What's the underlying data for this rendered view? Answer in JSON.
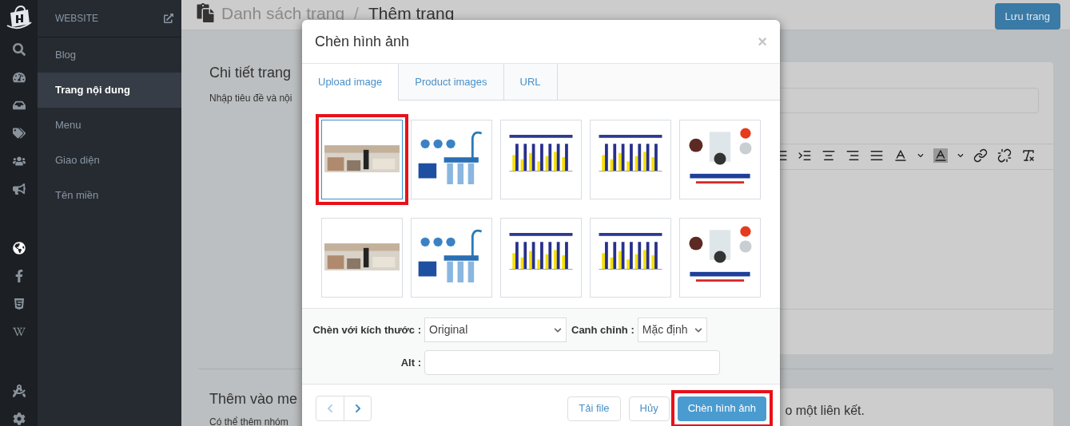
{
  "rail": {
    "icons": [
      {
        "kind": "search"
      },
      {
        "kind": "dashboard"
      },
      {
        "kind": "inbox"
      },
      {
        "kind": "tags"
      },
      {
        "kind": "users"
      },
      {
        "kind": "megaphone"
      },
      {
        "kind": "gap"
      },
      {
        "kind": "globe"
      },
      {
        "kind": "facebook"
      },
      {
        "kind": "html5"
      },
      {
        "kind": "w"
      },
      {
        "kind": "gap"
      },
      {
        "kind": "compass"
      },
      {
        "kind": "settings"
      }
    ]
  },
  "sidebar": {
    "title": "WEBSITE",
    "items": [
      {
        "label": "Blog",
        "selected": false
      },
      {
        "label": "Trang nội dung",
        "selected": true
      },
      {
        "label": "Menu",
        "selected": false
      },
      {
        "label": "Giao diện",
        "selected": false
      },
      {
        "label": "Tên miền",
        "selected": false
      }
    ]
  },
  "header": {
    "breadcrumb": [
      "Danh sách trang",
      "Thêm trang"
    ],
    "separator": "/",
    "save_button": "Lưu trang"
  },
  "page": {
    "section_title": "Chi tiết trang",
    "section_desc": "Nhập tiêu đề và nội",
    "menu_title": "Thêm vào me",
    "menu_desc": "Có thể thêm nhóm",
    "menu_right": "o một liên kết."
  },
  "modal": {
    "title": "Chèn hình ảnh",
    "close": "×",
    "tabs": [
      {
        "label": "Upload image",
        "selected": true
      },
      {
        "label": "Product images",
        "selected": false
      },
      {
        "label": "URL",
        "selected": false
      }
    ],
    "images": [
      {
        "kind": "picture",
        "selected": true,
        "highlighted": true
      },
      {
        "kind": "picture",
        "selected": false,
        "highlighted": false
      },
      {
        "kind": "picture",
        "selected": false,
        "highlighted": false
      },
      {
        "kind": "picture",
        "selected": false,
        "highlighted": false
      },
      {
        "kind": "picture",
        "selected": false,
        "highlighted": false
      },
      {
        "kind": "picture",
        "selected": false,
        "highlighted": false
      },
      {
        "kind": "picture",
        "selected": false,
        "highlighted": false
      },
      {
        "kind": "picture",
        "selected": false,
        "highlighted": false
      },
      {
        "kind": "picture",
        "selected": false,
        "highlighted": false
      },
      {
        "kind": "picture",
        "selected": false,
        "highlighted": false
      }
    ],
    "size_label": "Chèn với kích thước :",
    "size_value": "Original",
    "align_label": "Canh chỉnh :",
    "align_value": "Mặc định",
    "alt_label": "Alt :",
    "pager": [
      {
        "kind": "prev",
        "disabled": true
      },
      {
        "kind": "next",
        "disabled": false
      }
    ],
    "buttons": [
      {
        "label": "Tải file",
        "kind": "default",
        "highlighted": false
      },
      {
        "label": "Hủy",
        "kind": "default",
        "highlighted": false
      },
      {
        "label": "Chèn hình ảnh",
        "kind": "primary",
        "highlighted": true
      }
    ]
  }
}
